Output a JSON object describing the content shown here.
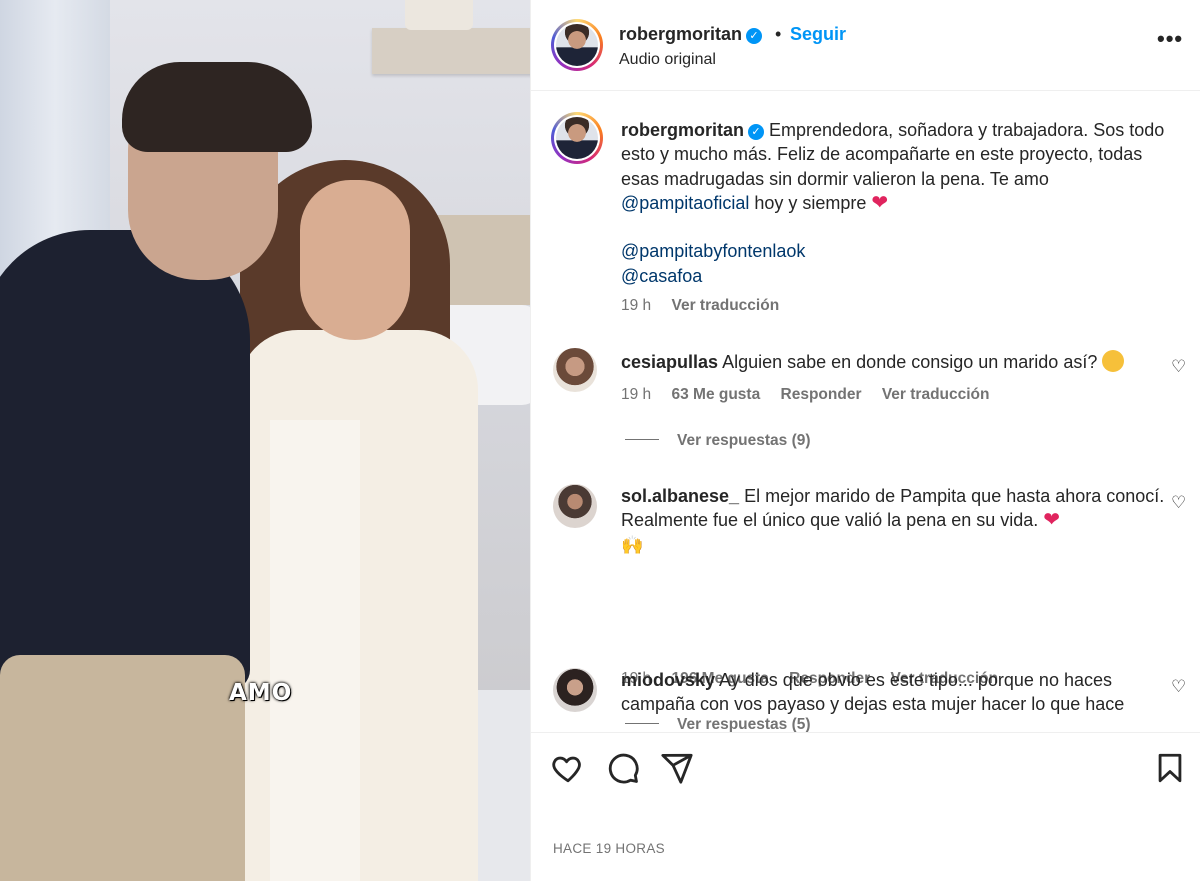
{
  "media": {
    "caption_overlay": "AMO"
  },
  "header": {
    "username": "robergmoritan",
    "separator": "•",
    "follow_label": "Seguir",
    "audio_label": "Audio original",
    "more_label": "•••"
  },
  "caption": {
    "username": "robergmoritan",
    "text_1": " Emprendedora, soñadora y trabajadora. Sos todo esto y mucho más. Feliz de acompañarte en este proyecto, todas esas madrugadas sin dormir valieron la pena. Te amo",
    "mention_1": "@pampitaoficial",
    "text_2": " hoy y siempre",
    "heart_emoji": "❤",
    "mention_2": "@pampitabyfontenlaok",
    "mention_3": "@casafoa",
    "time": "19 h",
    "translate": "Ver traducción"
  },
  "comments": [
    {
      "username": "cesiapullas",
      "text": " Alguien sabe en donde consigo un marido así?",
      "emoji": "🤔",
      "time": "19 h",
      "likes": "63 Me gusta",
      "reply": "Responder",
      "translate": "Ver traducción",
      "replies": "Ver respuestas (9)"
    },
    {
      "username": "sol.albanese_",
      "text": " El mejor marido de Pampita que hasta ahora conocí. Realmente fue el único que valió la pena en su vida.",
      "emoji": "❤",
      "emoji2": "🙌",
      "time": "19 h",
      "likes": "196 Me gusta",
      "reply": "Responder",
      "translate": "Ver traducción",
      "replies": "Ver respuestas (5)"
    },
    {
      "username": "miodovsky",
      "text": " Ay dios que obvio es este tipo... porque no haces campaña con vos payaso y dejas esta mujer hacer lo que hace"
    }
  ],
  "actions": {
    "like_icon": "heart-outline-icon",
    "comment_icon": "comment-icon",
    "share_icon": "send-icon",
    "save_icon": "bookmark-icon"
  },
  "post_date": "HACE 19 HORAS"
}
